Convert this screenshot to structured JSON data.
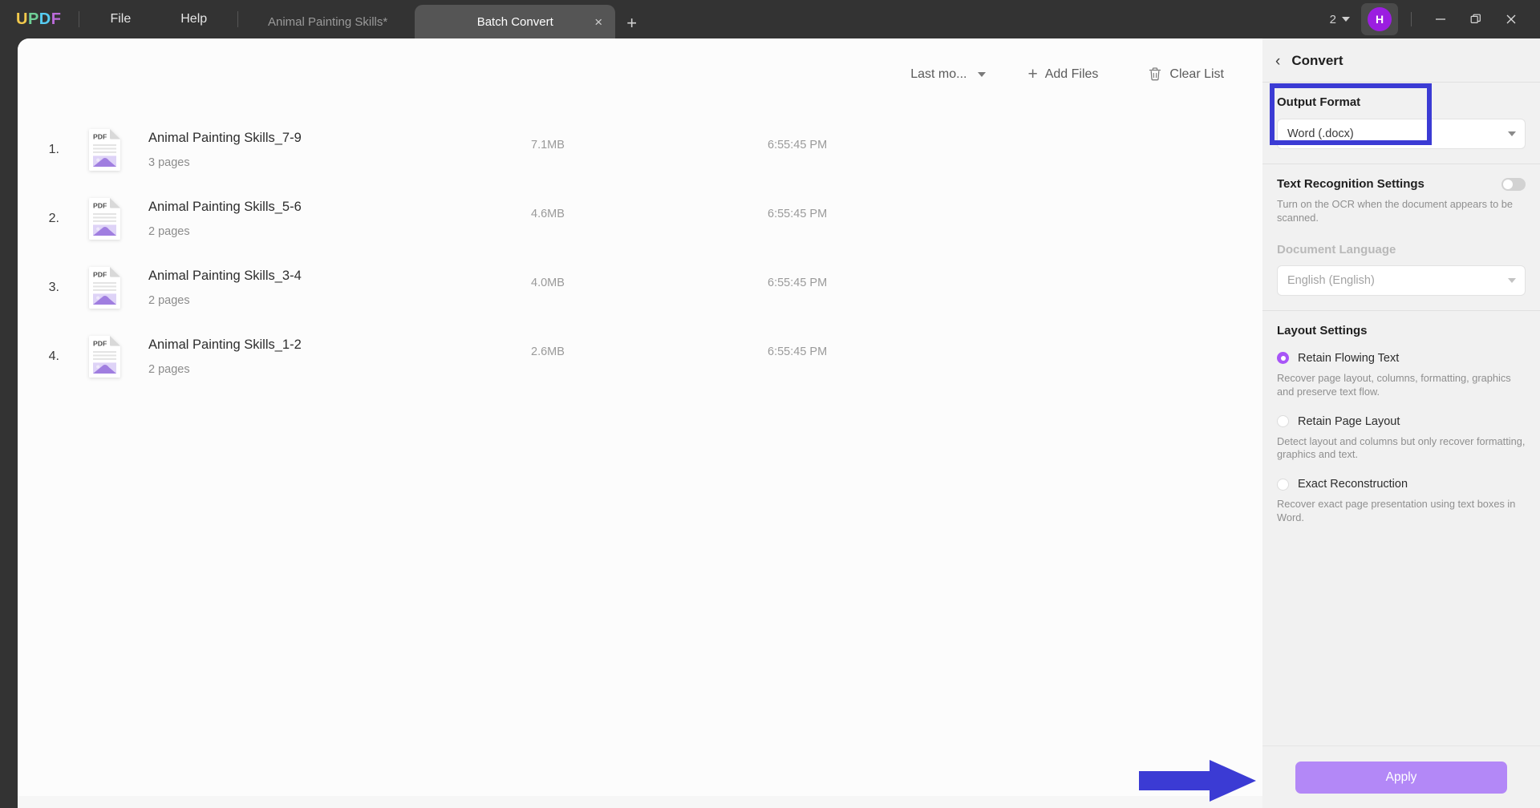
{
  "titlebar": {
    "logo": {
      "l1": "U",
      "l2": "P",
      "l3": "D",
      "l4": "F"
    },
    "menus": [
      {
        "label": "File",
        "name": "menu-file"
      },
      {
        "label": "Help",
        "name": "menu-help"
      }
    ],
    "tabs": [
      {
        "label": "Animal Painting Skills*",
        "active": false
      },
      {
        "label": "Batch Convert",
        "active": true
      }
    ],
    "new_tab_label": "+",
    "close_tab_label": "×",
    "page_count": "2",
    "avatar_initial": "H",
    "window_buttons": {
      "minimize": "minimize-icon",
      "maximize": "restore-icon",
      "close": "close-icon"
    }
  },
  "filelist": {
    "toolbar": {
      "sort_label": "Last mo...",
      "add_files_label": "Add Files",
      "add_files_icon": "plus-icon",
      "clear_list_label": "Clear List",
      "clear_list_icon": "trash-icon"
    },
    "rows": [
      {
        "index": "1.",
        "name": "Animal Painting Skills_7-9",
        "pages": "3 pages",
        "size": "7.1MB",
        "time": "6:55:45 PM",
        "icon": "pdf-file-icon"
      },
      {
        "index": "2.",
        "name": "Animal Painting Skills_5-6",
        "pages": "2 pages",
        "size": "4.6MB",
        "time": "6:55:45 PM",
        "icon": "pdf-file-icon"
      },
      {
        "index": "3.",
        "name": "Animal Painting Skills_3-4",
        "pages": "2 pages",
        "size": "4.0MB",
        "time": "6:55:45 PM",
        "icon": "pdf-file-icon"
      },
      {
        "index": "4.",
        "name": "Animal Painting Skills_1-2",
        "pages": "2 pages",
        "size": "2.6MB",
        "time": "6:55:45 PM",
        "icon": "pdf-file-icon"
      }
    ]
  },
  "panel": {
    "back_icon": "‹",
    "title": "Convert",
    "output_format": {
      "label": "Output Format",
      "value": "Word (.docx)"
    },
    "text_recognition": {
      "label": "Text Recognition Settings",
      "toggle_state": "off",
      "hint": "Turn on the OCR when the document appears to be scanned.",
      "language_label": "Document Language",
      "language_value": "English (English)"
    },
    "layout_settings": {
      "label": "Layout Settings",
      "options": [
        {
          "label": "Retain Flowing Text",
          "selected": true,
          "hint": "Recover page layout, columns, formatting, graphics and preserve text flow."
        },
        {
          "label": "Retain Page Layout",
          "selected": false,
          "hint": "Detect layout and columns but only recover formatting, graphics and text."
        },
        {
          "label": "Exact Reconstruction",
          "selected": false,
          "hint": "Recover exact page presentation using text boxes in Word."
        }
      ]
    },
    "apply_label": "Apply"
  },
  "annotations": {
    "highlight_color": "#3b3bd4",
    "arrow_color": "#3b3bd4",
    "highlight_target": "output-format-group",
    "arrow_target": "apply-button"
  },
  "colors": {
    "titlebar_bg": "#333333",
    "panel_bg": "#f1f1f1",
    "list_bg": "#fcfcfc",
    "accent_purple": "#a855f7",
    "apply_bg": "#b388f7",
    "avatar_bg": "#9b1ee0"
  }
}
